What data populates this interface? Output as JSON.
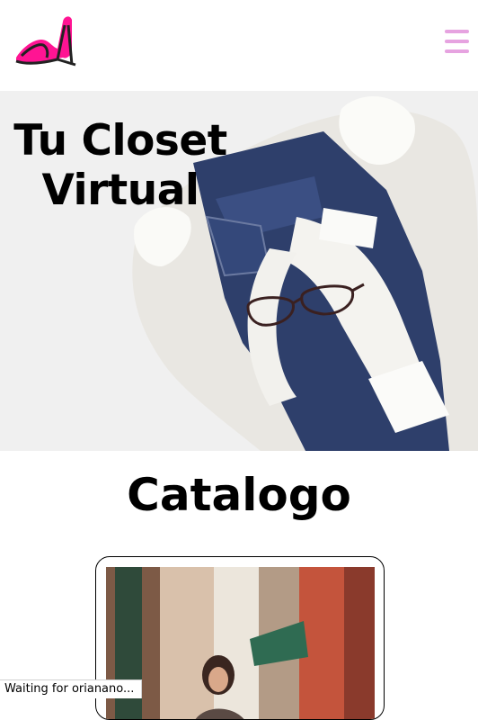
{
  "header": {
    "logo_icon": "high-heel-logo-icon",
    "menu_icon": "hamburger-menu-icon",
    "menu_color": "#e6a3e0",
    "logo_color": "#ff1493"
  },
  "hero": {
    "title_line1": "Tu Closet",
    "title_line2": "Virtual"
  },
  "catalog": {
    "title": "Catalogo"
  },
  "status_bar": {
    "text": "Waiting for orianano..."
  }
}
